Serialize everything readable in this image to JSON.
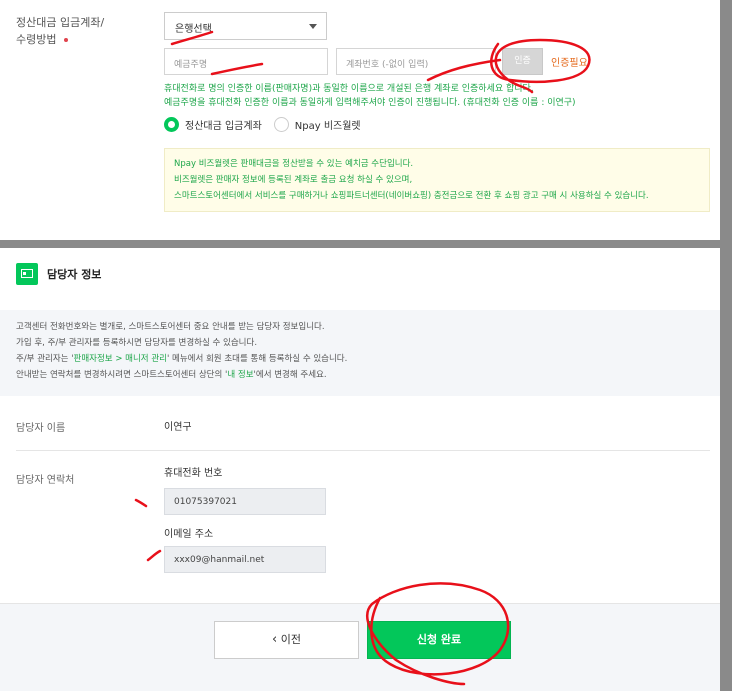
{
  "payout": {
    "label_line1": "정산대금 입금계좌/",
    "label_line2": "수령방법",
    "bank_select": "은행선택",
    "holder_placeholder": "예금주명",
    "account_placeholder": "계좌번호 (-없이 입력)",
    "auth_button": "인증",
    "auth_status": "인증필요",
    "guide_line1": "휴대전화로 명의 인증한 이름(판매자명)과 동일한 이름으로 개설된 은행 계좌로 인증하세요 합니다.",
    "guide_line2": "예금주명을 휴대전화 인증한 이름과 동일하게 입력해주셔야 인증이 진행됩니다. (휴대전화 인증 이름 : 이연구)",
    "radio_bank": "정산대금 입금계좌",
    "radio_npay": "Npay 비즈월렛",
    "npay_lines": [
      "Npay 비즈월렛은 판매대금을 정산받을 수 있는 예치금 수단입니다.",
      "비즈월렛은 판매자 정보에 등록된 계좌로 출금 요청 하실 수 있으며,",
      "스마트스토어센터에서 서비스를 구매하거나 쇼핑파트너센터(네이버쇼핑) 충전금으로 전환 후 쇼핑 광고 구매 시 사용하실 수 있습니다."
    ]
  },
  "manager": {
    "section_title": "담당자 정보",
    "info_line1": "고객센터 전화번호와는 별개로, 스마트스토어센터 중요 안내를 받는 담당자 정보입니다.",
    "info_line2": "가입 후, 주/부 관리자를 등록하시면 담당자를 변경하실 수 있습니다.",
    "info_line3_a": "주/부 관리자는 '",
    "info_line3_hl": "판매자정보 > 매니저 관리",
    "info_line3_b": "' 메뉴에서 회원 초대를 통해 등록하실 수 있습니다.",
    "info_line4_a": "안내받는 연락처를 변경하시려면 스마트스토어센터 상단의 '",
    "info_line4_hl": "내 정보",
    "info_line4_b": "'에서 변경해 주세요.",
    "name_label": "담당자 이름",
    "name_value": "이연구",
    "contact_label": "담당자 연락처",
    "phone_label": "휴대전화 번호",
    "phone_value": "01075397021",
    "email_label": "이메일 주소",
    "email_value": "xxx09@hanmail.net"
  },
  "footer": {
    "prev_button": "이전",
    "prev_icon": "chevron-left-icon",
    "done_button": "신청 완료"
  },
  "colors": {
    "accent": "#03c75a",
    "warning": "#e56b1f",
    "annotation": "#e8101a"
  }
}
